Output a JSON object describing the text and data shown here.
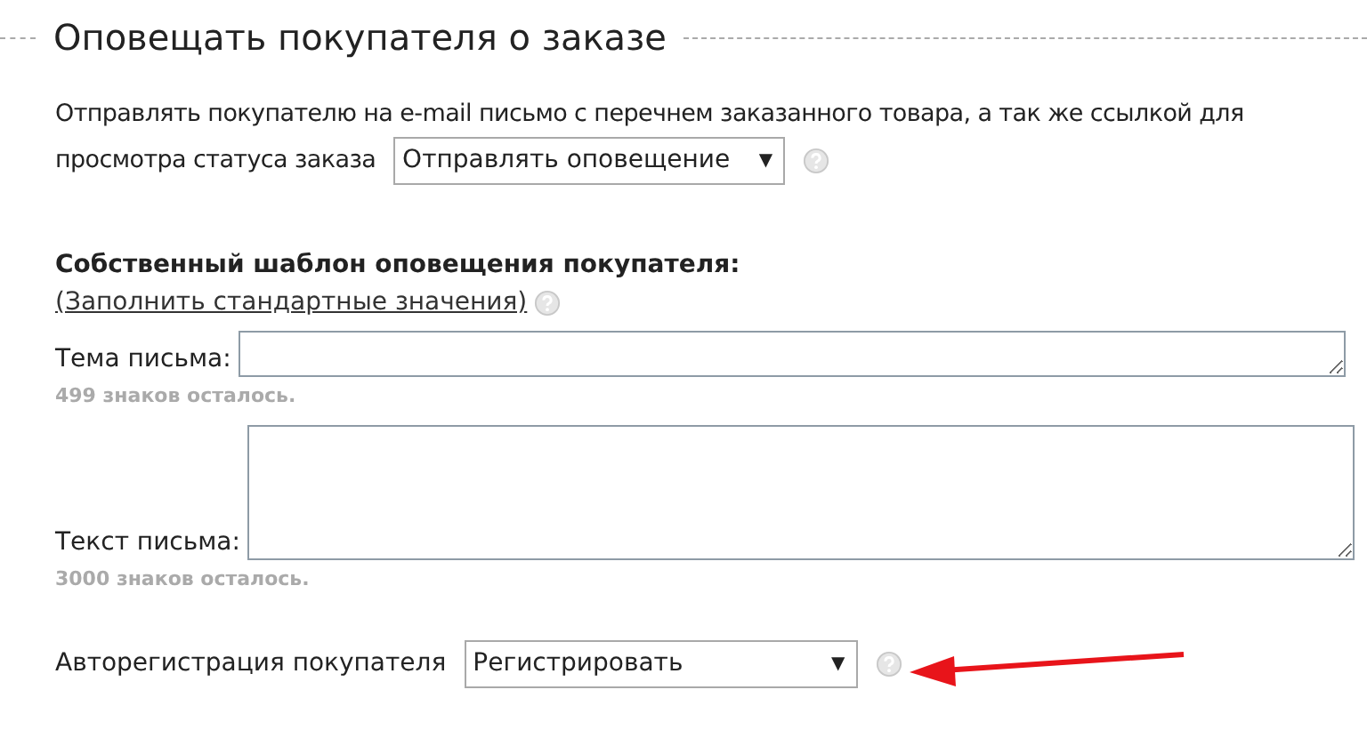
{
  "section_title": "Оповещать покупателя о заказе",
  "notify": {
    "text_lines": [
      "Отправлять покупателю на e-mail письмо с перечнем заказанного товара, а так же ссылкой для",
      "просмотра статуса заказа"
    ],
    "select_value": "Отправлять оповещение",
    "select_arrow": "▼"
  },
  "template": {
    "heading": "Собственный шаблон оповещения покупателя:",
    "fill_link": "(Заполнить стандартные значения)",
    "fields": [
      {
        "label": "Тема письма:",
        "counter": "499 знаков осталось."
      },
      {
        "label": "Текст письма:",
        "counter": "3000 знаков осталось."
      }
    ]
  },
  "autoreg": {
    "label": "Авторегистрация покупателя",
    "select_value": "Регистрировать",
    "select_arrow": "▼"
  }
}
